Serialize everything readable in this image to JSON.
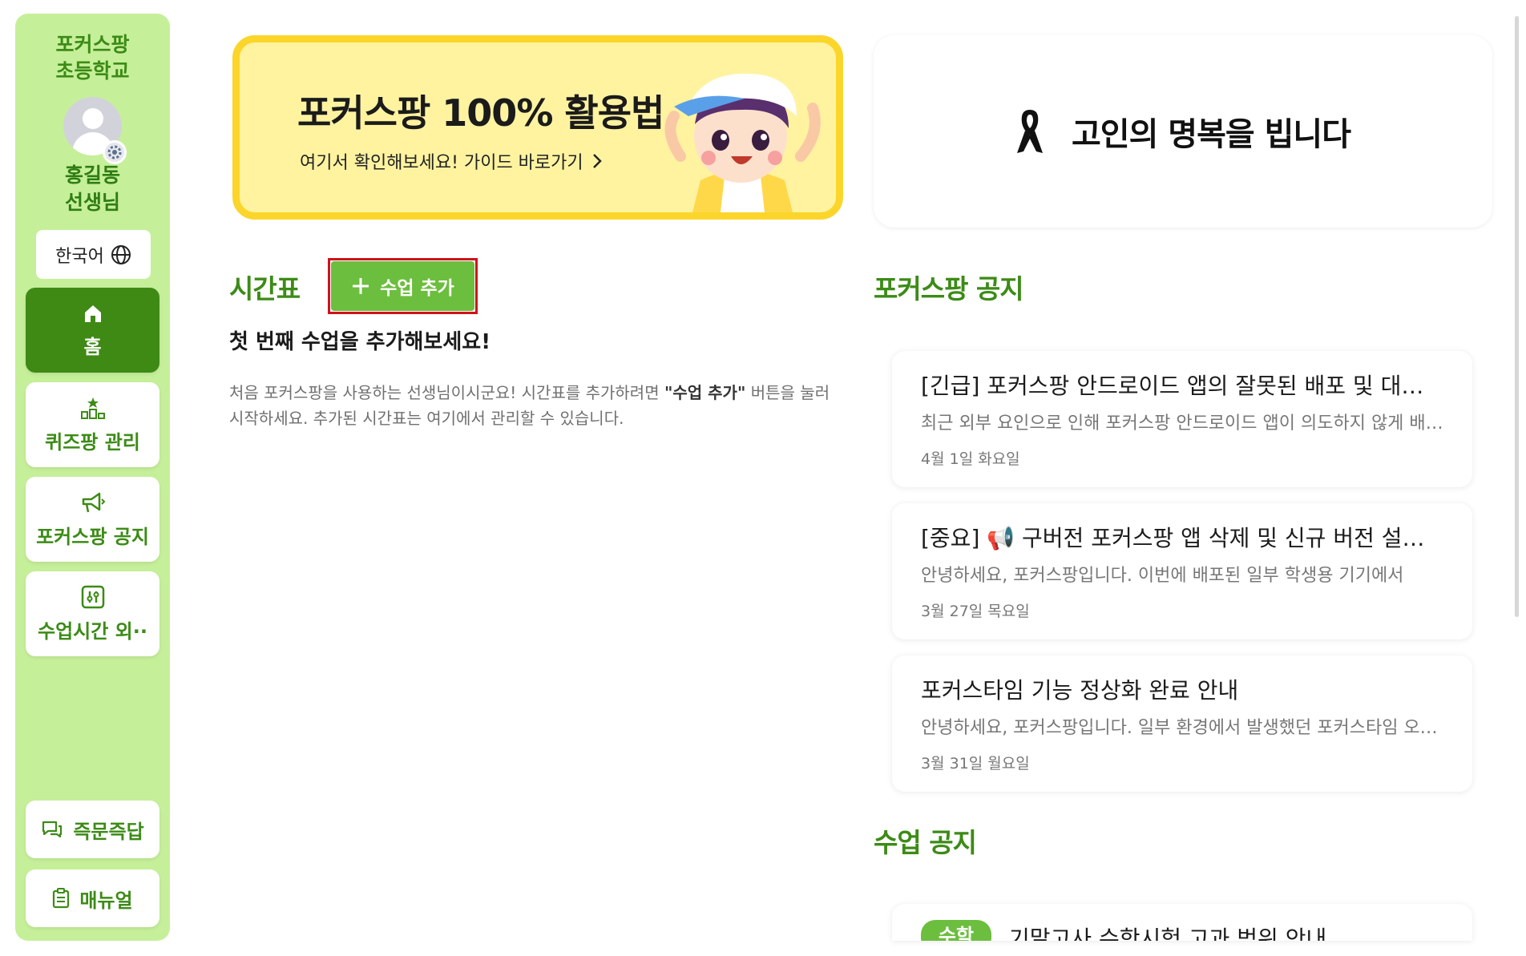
{
  "sidebar": {
    "school_name": "포커스팡\n초등학교",
    "user_name": "홍길동\n선생님",
    "language": "한국어",
    "nav": [
      {
        "label": "홈",
        "icon": "home-icon"
      },
      {
        "label": "퀴즈팡 관리",
        "icon": "quiz-icon"
      },
      {
        "label": "포커스팡 공지",
        "icon": "megaphone-icon"
      },
      {
        "label": "수업시간 외··",
        "icon": "settings-sliders-icon"
      }
    ],
    "bottom": [
      {
        "label": "즉문즉답",
        "icon": "chat-icon"
      },
      {
        "label": "매뉴얼",
        "icon": "clipboard-icon"
      }
    ]
  },
  "banner": {
    "title": "포커스팡 100% 활용법",
    "subtitle": "여기서 확인해보세요! 가이드 바로가기"
  },
  "memorial": {
    "text": "고인의 명복을 빕니다"
  },
  "timetable": {
    "title": "시간표",
    "add_button": "수업 추가",
    "empty_title": "첫 번째 수업을 추가해보세요!",
    "empty_desc_1": "처음 포커스팡을 사용하는 선생님이시군요! 시간표를 추가하려면 ",
    "empty_desc_bold": "\"수업 추가\"",
    "empty_desc_2": " 버튼을 눌러 시작하세요. 추가된 시간표는 여기에서 관리할 수 있습니다."
  },
  "notices": {
    "title": "포커스팡 공지",
    "items": [
      {
        "title": "[긴급] 포커스팡 안드로이드 앱의 잘못된 배포 및 대응 안내",
        "body": "최근 외부 요인으로 인해 포커스팡 안드로이드 앱이 의도하지 않게 배포되었습니다.",
        "date": "4월 1일 화요일"
      },
      {
        "title": "[중요] 📢 구버전 포커스팡 앱 삭제 및 신규 버전 설치 안내",
        "body": "안녕하세요, 포커스팡입니다. 이번에 배포된 일부 학생용 기기에서",
        "date": "3월 27일 목요일"
      },
      {
        "title": "포커스타임 기능 정상화 완료 안내",
        "body": "안녕하세요, 포커스팡입니다. 일부 환경에서 발생했던 포커스타임 오류가",
        "date": "3월 31일 월요일"
      }
    ]
  },
  "class_notices": {
    "title": "수업 공지",
    "items": [
      {
        "badge": "수학",
        "title": "기말고사 수학시험 고과 범위 안내"
      }
    ]
  },
  "colors": {
    "brand_green": "#3c8b16",
    "sidebar_bg": "#c6ef9a",
    "button_green": "#6cbe3e",
    "banner_bg": "#fff3a0",
    "banner_border": "#fbd52a",
    "highlight_red": "#d0111b"
  }
}
